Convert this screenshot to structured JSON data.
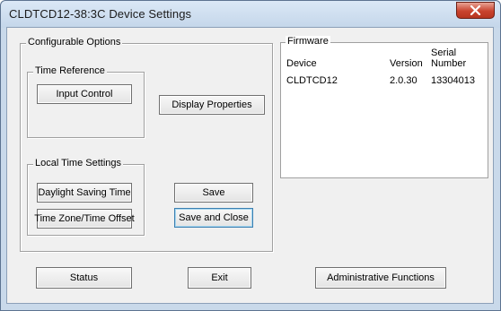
{
  "window": {
    "title": "CLDTCD12-38:3C  Device Settings"
  },
  "configurable": {
    "legend": "Configurable Options",
    "time_reference": {
      "legend": "Time Reference",
      "input_control": "Input Control"
    },
    "display_properties": "Display Properties",
    "local_time": {
      "legend": "Local Time Settings",
      "daylight_saving": "Daylight Saving Time",
      "time_zone": "Time Zone/Time Offset"
    },
    "save": "Save",
    "save_and_close": "Save and Close"
  },
  "firmware": {
    "legend": "Firmware",
    "columns": {
      "device": "Device",
      "version": "Version",
      "serial_line1": "Serial",
      "serial_line2": "Number"
    },
    "row": {
      "device": "CLDTCD12",
      "version": "2.0.30",
      "serial": "13304013"
    }
  },
  "bottom": {
    "status": "Status",
    "exit": "Exit",
    "admin": "Administrative Functions"
  },
  "colors": {
    "titlebar": "#c4d6ea",
    "close": "#c9432e",
    "client": "#f0f0f0",
    "default_button_border": "#3c7fb1"
  },
  "icons": {
    "close": "close-icon"
  }
}
